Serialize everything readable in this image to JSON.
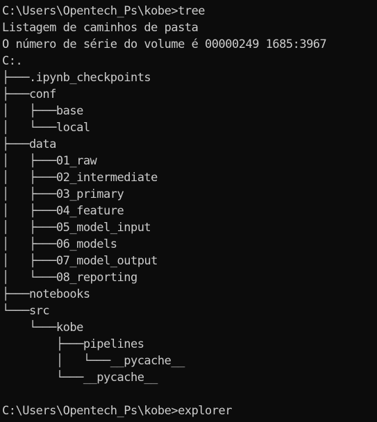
{
  "colors": {
    "background": "#0c0c0c",
    "foreground": "#cccccc"
  },
  "console": {
    "lines": [
      "C:\\Users\\Opentech_Ps\\kobe>tree",
      "Listagem de caminhos de pasta",
      "O número de série do volume é 00000249 1685:3967",
      "C:.",
      "├───.ipynb_checkpoints",
      "├───conf",
      "│   ├───base",
      "│   └───local",
      "├───data",
      "│   ├───01_raw",
      "│   ├───02_intermediate",
      "│   ├───03_primary",
      "│   ├───04_feature",
      "│   ├───05_model_input",
      "│   ├───06_models",
      "│   ├───07_model_output",
      "│   └───08_reporting",
      "├───notebooks",
      "└───src",
      "    └───kobe",
      "        ├───pipelines",
      "        │   └───__pycache__",
      "        └───__pycache__",
      "",
      "C:\\Users\\Opentech_Ps\\kobe>explorer"
    ]
  }
}
